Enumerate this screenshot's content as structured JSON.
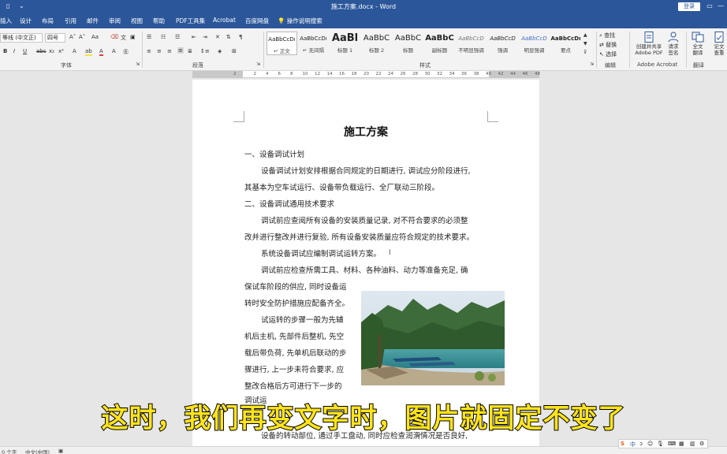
{
  "titlebar": {
    "doc_title": "施工方案.docx - Word",
    "login_label": "登录",
    "min_glyph": "—",
    "max_glyph": "▢",
    "close_glyph": "✕"
  },
  "tabs": {
    "items": [
      "插入",
      "设计",
      "布局",
      "引用",
      "邮件",
      "审阅",
      "视图",
      "帮助",
      "PDF工具集",
      "Acrobat",
      "百度网盘"
    ],
    "search_label": "操作说明搜索"
  },
  "ribbon": {
    "font_name": "等线 (中文正)",
    "font_size": "四号",
    "font_group_label": "字体",
    "para_group_label": "段落",
    "style_group_label": "样式",
    "edit_group_label": "编辑",
    "acrobat_group_label": "Adobe Acrobat",
    "translate_group_label": "翻译",
    "styles": [
      {
        "sample": "AaBbCcDı",
        "name": "↵ 正文"
      },
      {
        "sample": "AaBbCcDı",
        "name": "↵ 无间隔"
      },
      {
        "sample": "AaBl",
        "name": "标题 1"
      },
      {
        "sample": "AaBbC",
        "name": "标题 2"
      },
      {
        "sample": "AaBbC",
        "name": "标题"
      },
      {
        "sample": "AaBbC",
        "name": "副标题"
      },
      {
        "sample": "AaBbCcD",
        "name": "不明显强调"
      },
      {
        "sample": "AaBbCcD",
        "name": "强调"
      },
      {
        "sample": "AaBbCcD",
        "name": "明显强调"
      },
      {
        "sample": "AaBbCcDı",
        "name": "要点"
      }
    ],
    "edit": {
      "find": "查找",
      "replace": "替换",
      "select": "选择"
    },
    "acrobat": {
      "create_share": "创建并共享",
      "create_share_2": "Adobe PDF",
      "request_sign": "请求",
      "request_sign_2": "签名"
    },
    "translate": {
      "full_1": "全文",
      "full_2": "翻译",
      "paper_1": "论文",
      "paper_2": "查重"
    }
  },
  "ruler": {
    "numbers": [
      "2",
      "2",
      "4",
      "6",
      "8",
      "10",
      "12",
      "14",
      "16",
      "18",
      "20",
      "22",
      "24",
      "26",
      "28",
      "30",
      "32",
      "34",
      "36",
      "38",
      "40",
      "42",
      "44",
      "46",
      "48"
    ]
  },
  "document": {
    "title": "施工方案",
    "lines": [
      "一、设备调试计划",
      "设备调试计划安排根据合同规定的日期进行, 调试应分阶段进行,",
      "其基本为空车试运行、设备带负载运行、全厂联动三阶段。",
      "二、设备调试通用技术要求",
      "调试前应查阅所有设备的安装质量记录, 对不符合要求的必须整",
      "改并进行整改并进行复验, 所有设备安装质量应符合规定的技术要求。",
      "系统设备调试应编制调试运转方案。",
      "调试前应检查所需工具、材料、各种油料、动力等准备充足, 确",
      "保试车阶段的供应, 同时设备运",
      "转时安全防护措施应配备齐全。",
      "试运转的步骤一般为先辅",
      "机后主机, 先部件后整机, 先空",
      "载后带负荷, 先单机后联动的步",
      "骤进行, 上一步未符合要求, 应",
      "整改合格后方可进行下一步的",
      "调试运",
      "设备的转动部位, 通过手工盘动, 同时应检查润滑情况是否良好,"
    ]
  },
  "subtitle": "这时，我们再变文字时，图片就固定不变了",
  "statusbar": {
    "words": "0 个字",
    "lang": "中文(中国)"
  },
  "ime": {
    "mode": "中"
  }
}
